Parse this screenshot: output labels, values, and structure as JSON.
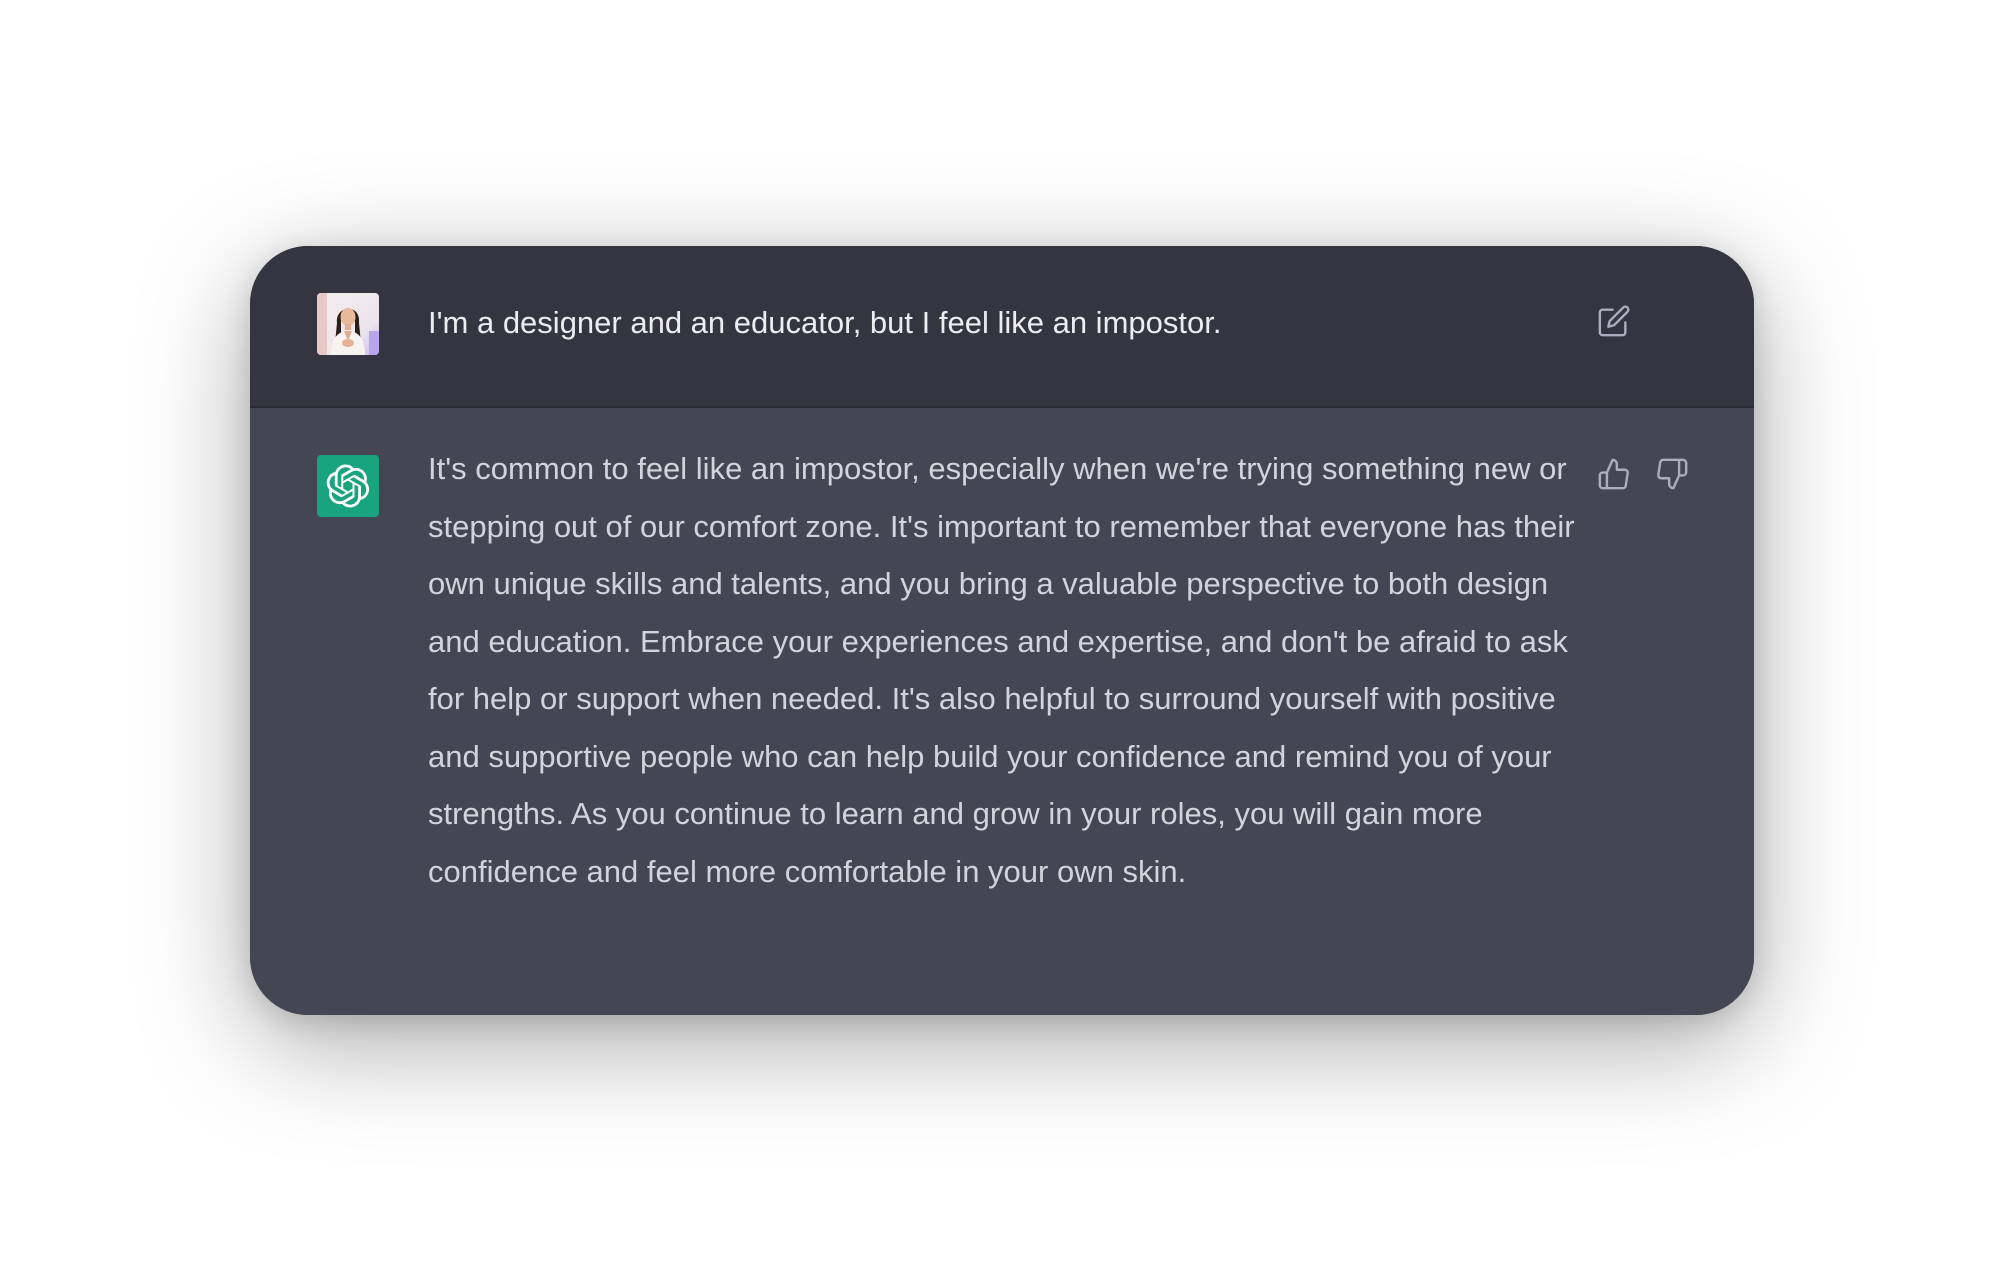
{
  "conversation": {
    "user_message": {
      "avatar_icon": "user-photo-avatar",
      "text": "I'm a designer and an educator, but I feel like an impostor.",
      "edit_icon": "edit-pencil-icon"
    },
    "assistant_message": {
      "avatar_icon": "openai-logo-icon",
      "avatar_color": "#19a37f",
      "text": "It's common to feel like an impostor, especially when we're trying something new or stepping out of our comfort zone. It's important to remember that everyone has their own unique skills and talents, and you bring a valuable perspective to both design and education. Embrace your experiences and expertise, and don't be afraid to ask for help or support when needed. It's also helpful to surround yourself with positive and supportive people who can help build your confidence and remind you of your strengths. As you continue to learn and grow in your roles, you will gain more confidence and feel more comfortable in your own skin.",
      "feedback_icons": [
        "thumbs-up-icon",
        "thumbs-down-icon"
      ]
    }
  },
  "colors": {
    "user_row_bg": "#343541",
    "assistant_row_bg": "#444654",
    "user_text": "#ececf1",
    "assistant_text": "#d1d5db",
    "icon_color": "#acacbe"
  }
}
